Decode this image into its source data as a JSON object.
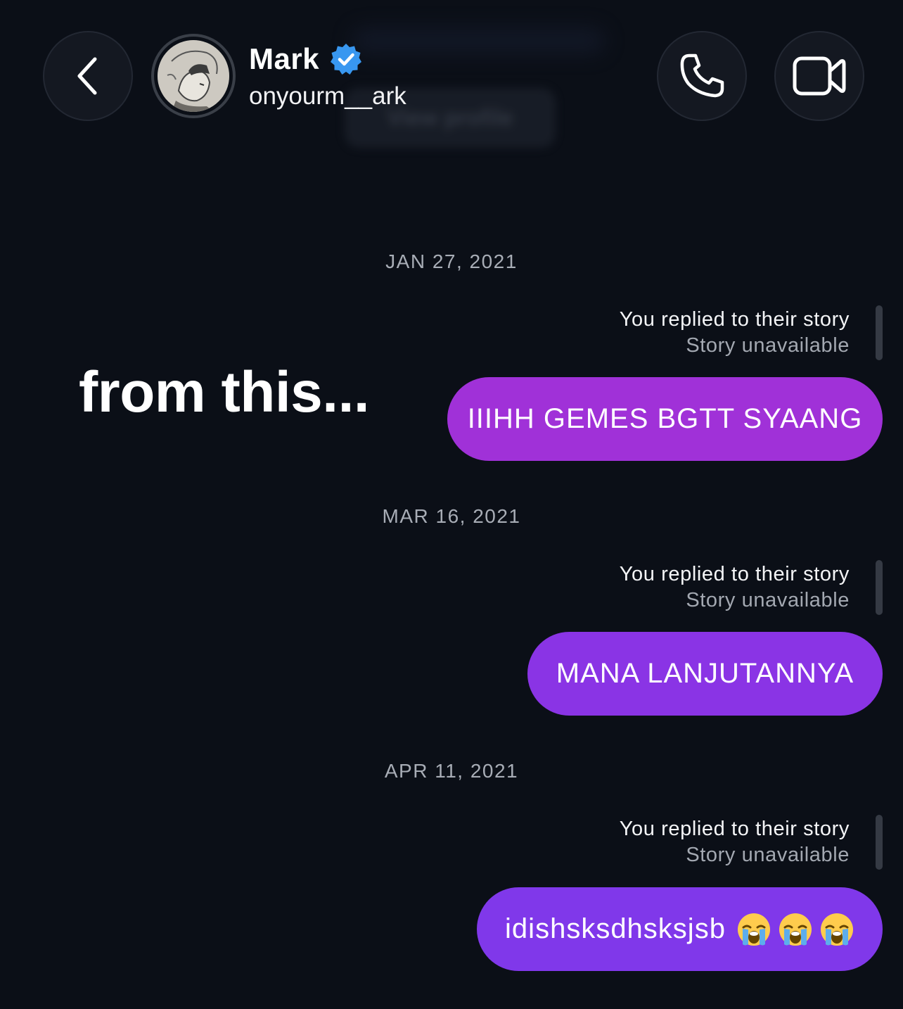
{
  "header": {
    "name": "Mark",
    "username": "onyourm__ark",
    "ghost_button_label": "View profile",
    "verified_color": "#3897f0"
  },
  "overlay": {
    "text": "from this..."
  },
  "thread": [
    {
      "date": "JAN 27, 2021",
      "reply_title": "You replied to their story",
      "reply_sub": "Story unavailable",
      "message": "IIIHH GEMES BGTT SYAANG",
      "bubble_color": "#a031d8"
    },
    {
      "date": "MAR 16, 2021",
      "reply_title": "You replied to their story",
      "reply_sub": "Story unavailable",
      "message": "MANA LANJUTANNYA",
      "bubble_color": "#8a34e5"
    },
    {
      "date": "APR 11, 2021",
      "reply_title": "You replied to their story",
      "reply_sub": "Story unavailable",
      "message": "idishsksdhsksjsb",
      "emoji": [
        "loudly-crying-face",
        "loudly-crying-face",
        "loudly-crying-face"
      ],
      "bubble_color": "#8038ea"
    }
  ]
}
